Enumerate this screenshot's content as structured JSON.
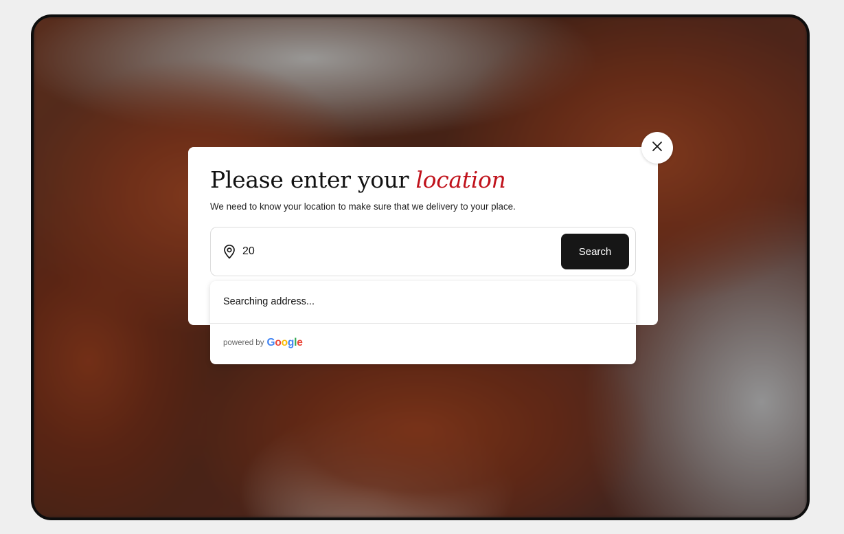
{
  "modal": {
    "title_main": "Please enter your ",
    "title_accent": "location",
    "subtitle": "We need to know your location to make sure that we delivery to your place.",
    "close_icon": "close-icon"
  },
  "search": {
    "icon": "map-pin-icon",
    "value": "20",
    "button_label": "Search"
  },
  "dropdown": {
    "status": "Searching address...",
    "powered_by": "powered by",
    "logo_text": "Google"
  },
  "colors": {
    "accent": "#c0121b",
    "button": "#161616",
    "google_blue": "#4285F4",
    "google_red": "#EA4335",
    "google_yellow": "#FBBC05",
    "google_green": "#34A853"
  }
}
